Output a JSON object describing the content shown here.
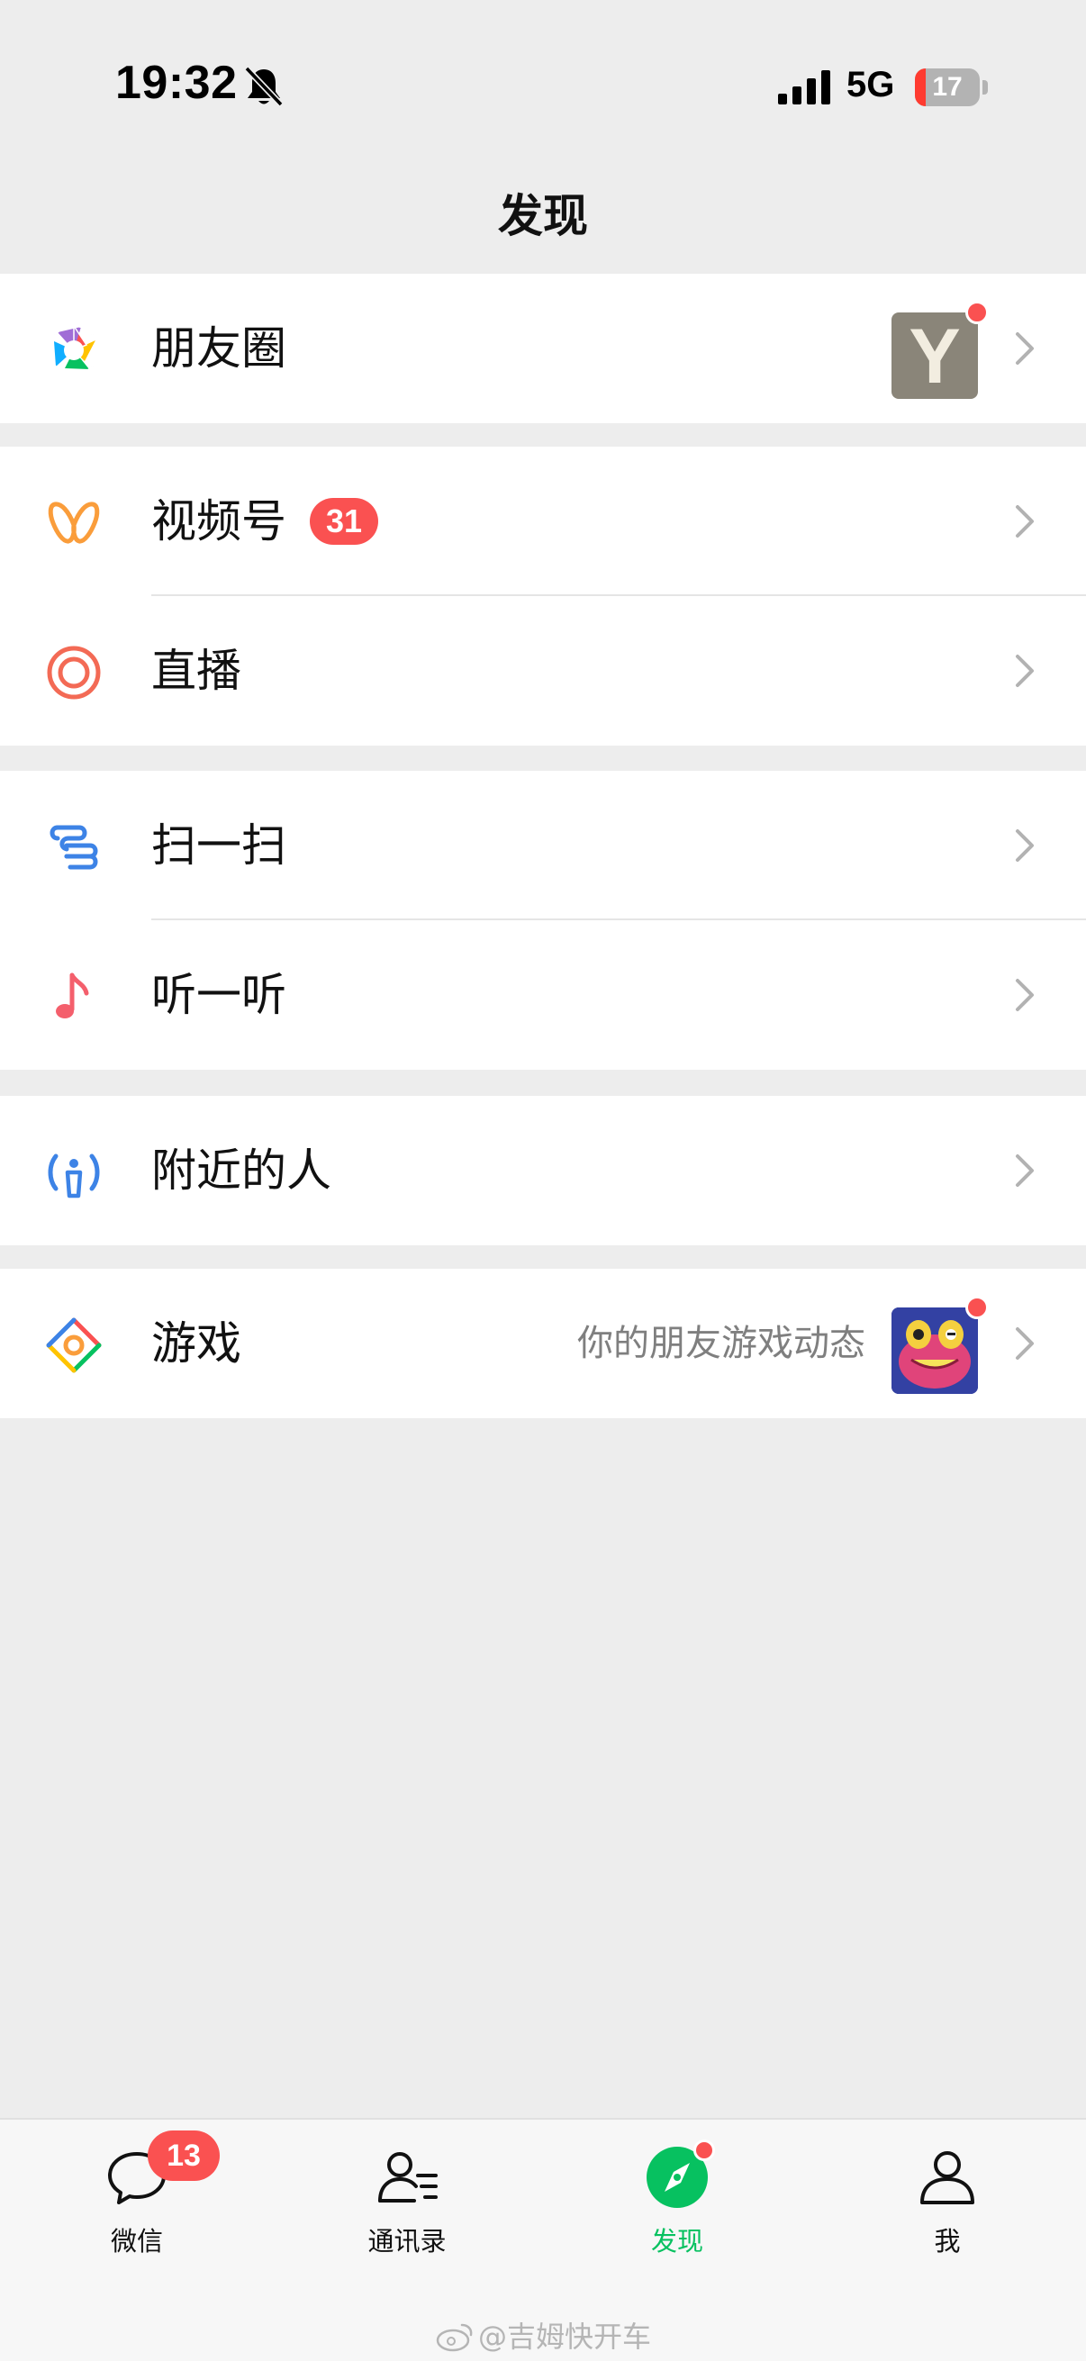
{
  "status_bar": {
    "time": "19:32",
    "network": "5G",
    "battery_level": "17",
    "battery_fraction": 0.17,
    "icons": [
      "bell-muted-icon",
      "cellular-signal-icon",
      "battery-icon"
    ]
  },
  "nav": {
    "title": "发现"
  },
  "menu": {
    "moments": {
      "label": "朋友圈",
      "icon": "moments-aperture-icon",
      "thumb_letter": "Y"
    },
    "channels": {
      "label": "视频号",
      "badge": "31",
      "icon": "channels-butterfly-icon"
    },
    "live": {
      "label": "直播",
      "icon": "live-broadcast-icon"
    },
    "scan": {
      "label": "扫一扫",
      "icon": "scan-icon"
    },
    "listen": {
      "label": "听一听",
      "icon": "music-note-icon"
    },
    "nearby": {
      "label": "附近的人",
      "icon": "nearby-people-icon"
    },
    "games": {
      "label": "游戏",
      "sublabel": "你的朋友游戏动态",
      "icon": "games-diamond-icon"
    }
  },
  "tab_bar": {
    "tabs": [
      {
        "label": "微信",
        "badge": "13",
        "icon": "chat-bubble-icon"
      },
      {
        "label": "通讯录",
        "icon": "contacts-icon"
      },
      {
        "label": "发现",
        "icon": "compass-icon"
      },
      {
        "label": "我",
        "icon": "person-icon"
      }
    ]
  },
  "watermark": {
    "text": "@吉姆快开车"
  },
  "colors": {
    "accent_green": "#07c160",
    "badge_red": "#fa5151",
    "background": "#ededed",
    "row_background": "#ffffff"
  }
}
